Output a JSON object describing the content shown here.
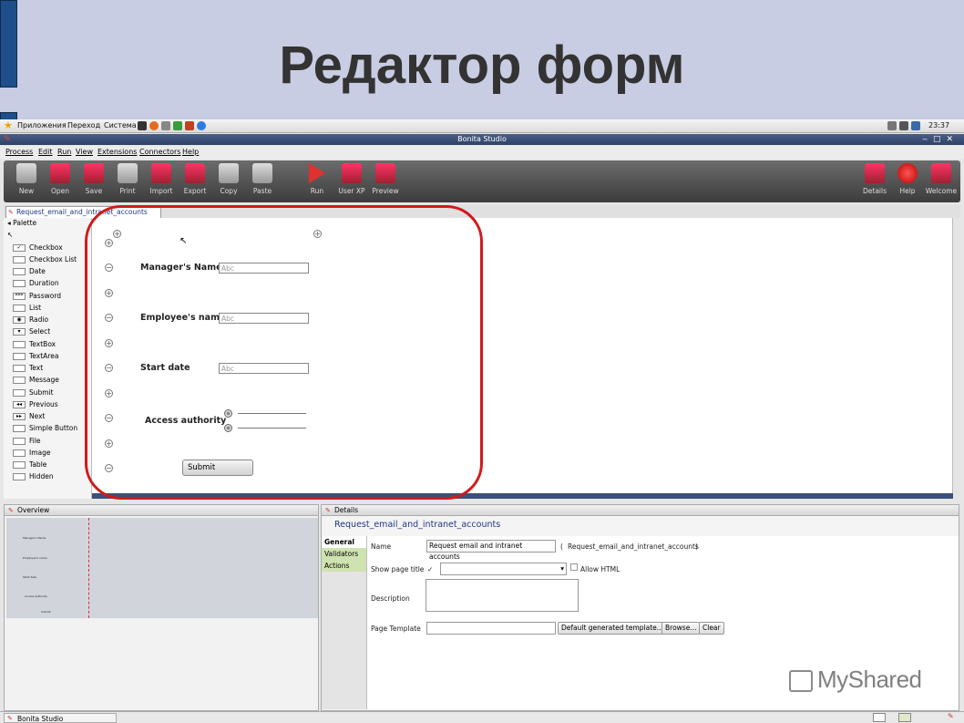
{
  "slide": {
    "title": "Редактор форм",
    "watermark": "MyShared"
  },
  "gnome_panel": {
    "apps": "Приложения",
    "places": "Переход",
    "system": "Система",
    "clock": "23:37"
  },
  "window": {
    "title": "Bonita Studio"
  },
  "menu": [
    "Process",
    "Edit",
    "Run",
    "View",
    "Extensions",
    "Connectors",
    "Help"
  ],
  "toolbar": {
    "left": [
      "New",
      "Open",
      "Save",
      "Print",
      "Import",
      "Export",
      "Copy",
      "Paste",
      "Run",
      "User XP",
      "Preview"
    ],
    "right": [
      "Details",
      "Help",
      "Welcome"
    ]
  },
  "editor_tab": "Request_email_and_intranet_accounts",
  "palette": {
    "title": "Palette",
    "items": [
      "Checkbox",
      "Checkbox List",
      "Date",
      "Duration",
      "Password",
      "List",
      "Radio",
      "Select",
      "TextBox",
      "TextArea",
      "Text",
      "Message",
      "Submit",
      "Previous",
      "Next",
      "Simple Button",
      "File",
      "Image",
      "Table",
      "Hidden"
    ]
  },
  "form": {
    "fields": [
      {
        "label": "Manager's Name",
        "placeholder": "Abc"
      },
      {
        "label": "Employee's name",
        "placeholder": "Abc"
      },
      {
        "label": "Start date",
        "placeholder": "Abc"
      }
    ],
    "radio_label": "Access authority",
    "submit": "Submit"
  },
  "overview": {
    "title": "Overview",
    "labels": [
      "Manager's Name",
      "Employee's name",
      "Start date",
      "Access authority",
      "Submit"
    ]
  },
  "details": {
    "header": "Details",
    "title": "Request_email_and_intranet_accounts",
    "tabs": [
      "General",
      "Validators",
      "Actions"
    ],
    "name_label": "Name",
    "name_value": "Request email and intranet accounts",
    "id_value": "Request_email_and_intranet_accounts",
    "show_title_label": "Show page title",
    "allow_html": "Allow HTML",
    "description_label": "Description",
    "template_label": "Page Template",
    "template_btn": "Default generated template...",
    "browse": "Browse...",
    "clear": "Clear"
  },
  "statusbar": {
    "task": "Bonita Studio"
  }
}
